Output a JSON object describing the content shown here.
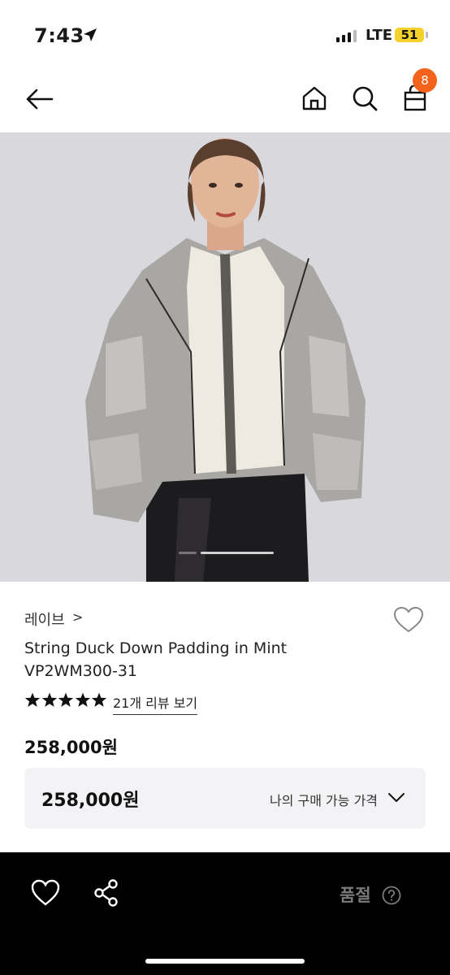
{
  "status_bar": {
    "time": "7:43",
    "network": "LTE",
    "battery": "51"
  },
  "nav": {
    "cart_count": "8"
  },
  "product": {
    "brand": "레이브",
    "brand_chevron": ">",
    "name_line1": "String Duck Down Padding in Mint",
    "name_line2": "VP2WM300-31",
    "rating_stars": 5,
    "review_link": "21개 리뷰 보기",
    "price": "258,000원"
  },
  "price_box": {
    "price": "258,000원",
    "label": "나의 구매 가능 가격"
  },
  "bottom_bar": {
    "status": "품절"
  },
  "colors": {
    "badge": "#f4631c",
    "battery": "#f5d12b",
    "bottom_bar": "#000000",
    "price_box_bg": "#f3f3f5"
  }
}
